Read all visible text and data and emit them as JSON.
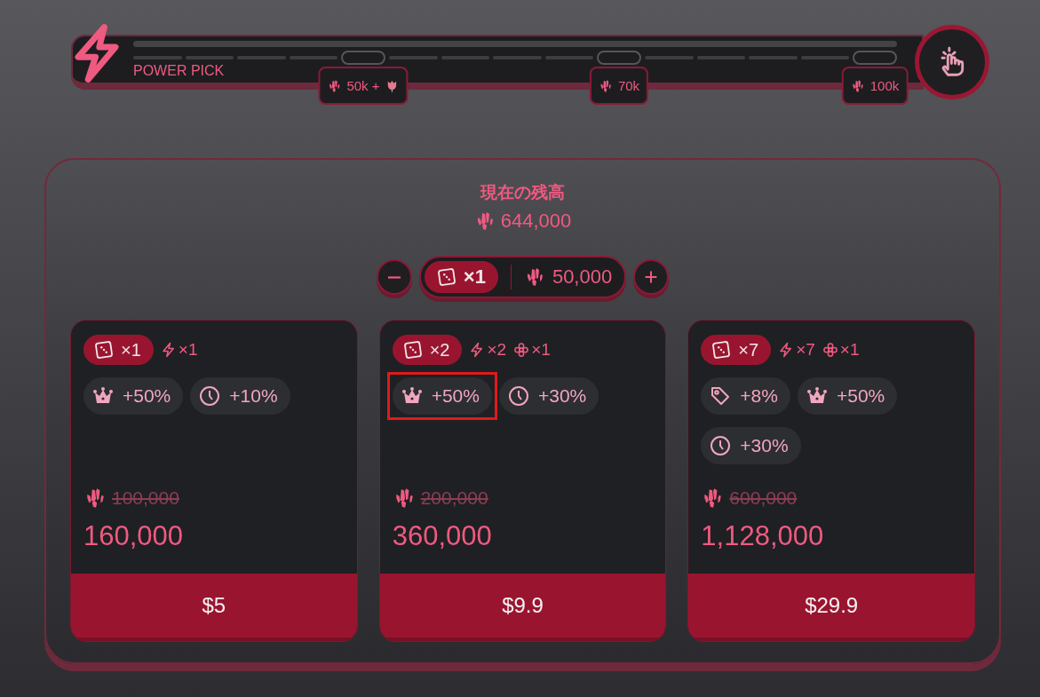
{
  "power_pick": {
    "label": "POWER PICK",
    "milestones": [
      {
        "reward": "50k +",
        "bonus_item": true
      },
      {
        "reward": "70k",
        "bonus_item": false
      },
      {
        "reward": "100k",
        "bonus_item": false
      }
    ]
  },
  "balance": {
    "label": "現在の残高",
    "amount": "644,000"
  },
  "stepper": {
    "quantity": "×1",
    "cost": "50,000"
  },
  "packs": [
    {
      "dice": "×1",
      "extras": [
        {
          "kind": "bolt",
          "text": "×1"
        }
      ],
      "bonuses": [
        {
          "kind": "crown",
          "text": "+50%",
          "highlighted": false
        },
        {
          "kind": "clock",
          "text": "+10%",
          "highlighted": false
        }
      ],
      "old_amount": "100,000",
      "amount": "160,000",
      "price": "$5"
    },
    {
      "dice": "×2",
      "extras": [
        {
          "kind": "bolt",
          "text": "×2"
        },
        {
          "kind": "flower",
          "text": "×1"
        }
      ],
      "bonuses": [
        {
          "kind": "crown",
          "text": "+50%",
          "highlighted": true
        },
        {
          "kind": "clock",
          "text": "+30%",
          "highlighted": false
        }
      ],
      "old_amount": "200,000",
      "amount": "360,000",
      "price": "$9.9"
    },
    {
      "dice": "×7",
      "extras": [
        {
          "kind": "bolt",
          "text": "×7"
        },
        {
          "kind": "flower",
          "text": "×1"
        }
      ],
      "bonuses": [
        {
          "kind": "tag",
          "text": "+8%",
          "highlighted": false
        },
        {
          "kind": "crown",
          "text": "+50%",
          "highlighted": false
        },
        {
          "kind": "clock",
          "text": "+30%",
          "highlighted": false
        }
      ],
      "old_amount": "600,000",
      "amount": "1,128,000",
      "price": "$29.9"
    }
  ]
}
